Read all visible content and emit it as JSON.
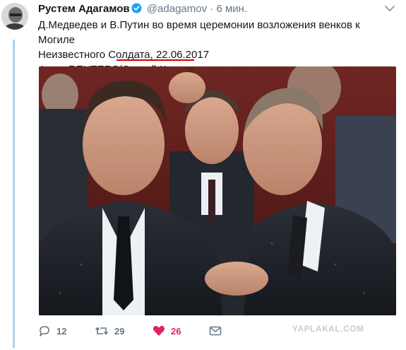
{
  "author": {
    "name": "Рустем Адагамов",
    "handle": "@adagamov",
    "separator": "·",
    "time": "6 мин."
  },
  "tweet": {
    "text_line1": "Д.Медведев и В.Путин во время церемонии возложения венков к Могиле",
    "text_line2": "Неизвестного Солдата, 22.06.2017",
    "credit_prefix": "Фото: REUTERS/",
    "credit_name": "Сергей Карпухин"
  },
  "actions": {
    "reply_count": "12",
    "retweet_count": "29",
    "like_count": "26"
  },
  "watermark": "YAPLAKAL.COM",
  "icons": {
    "verified": "verified-badge-icon",
    "caret": "chevron-down-icon",
    "reply": "reply-icon",
    "retweet": "retweet-icon",
    "like": "heart-icon",
    "message": "direct-message-icon"
  },
  "colors": {
    "verified_blue": "#1da1f2",
    "muted_text": "#657786",
    "like_red": "#e0245e",
    "thread_line": "#aad2ee",
    "credit_underline": "#d00000"
  }
}
